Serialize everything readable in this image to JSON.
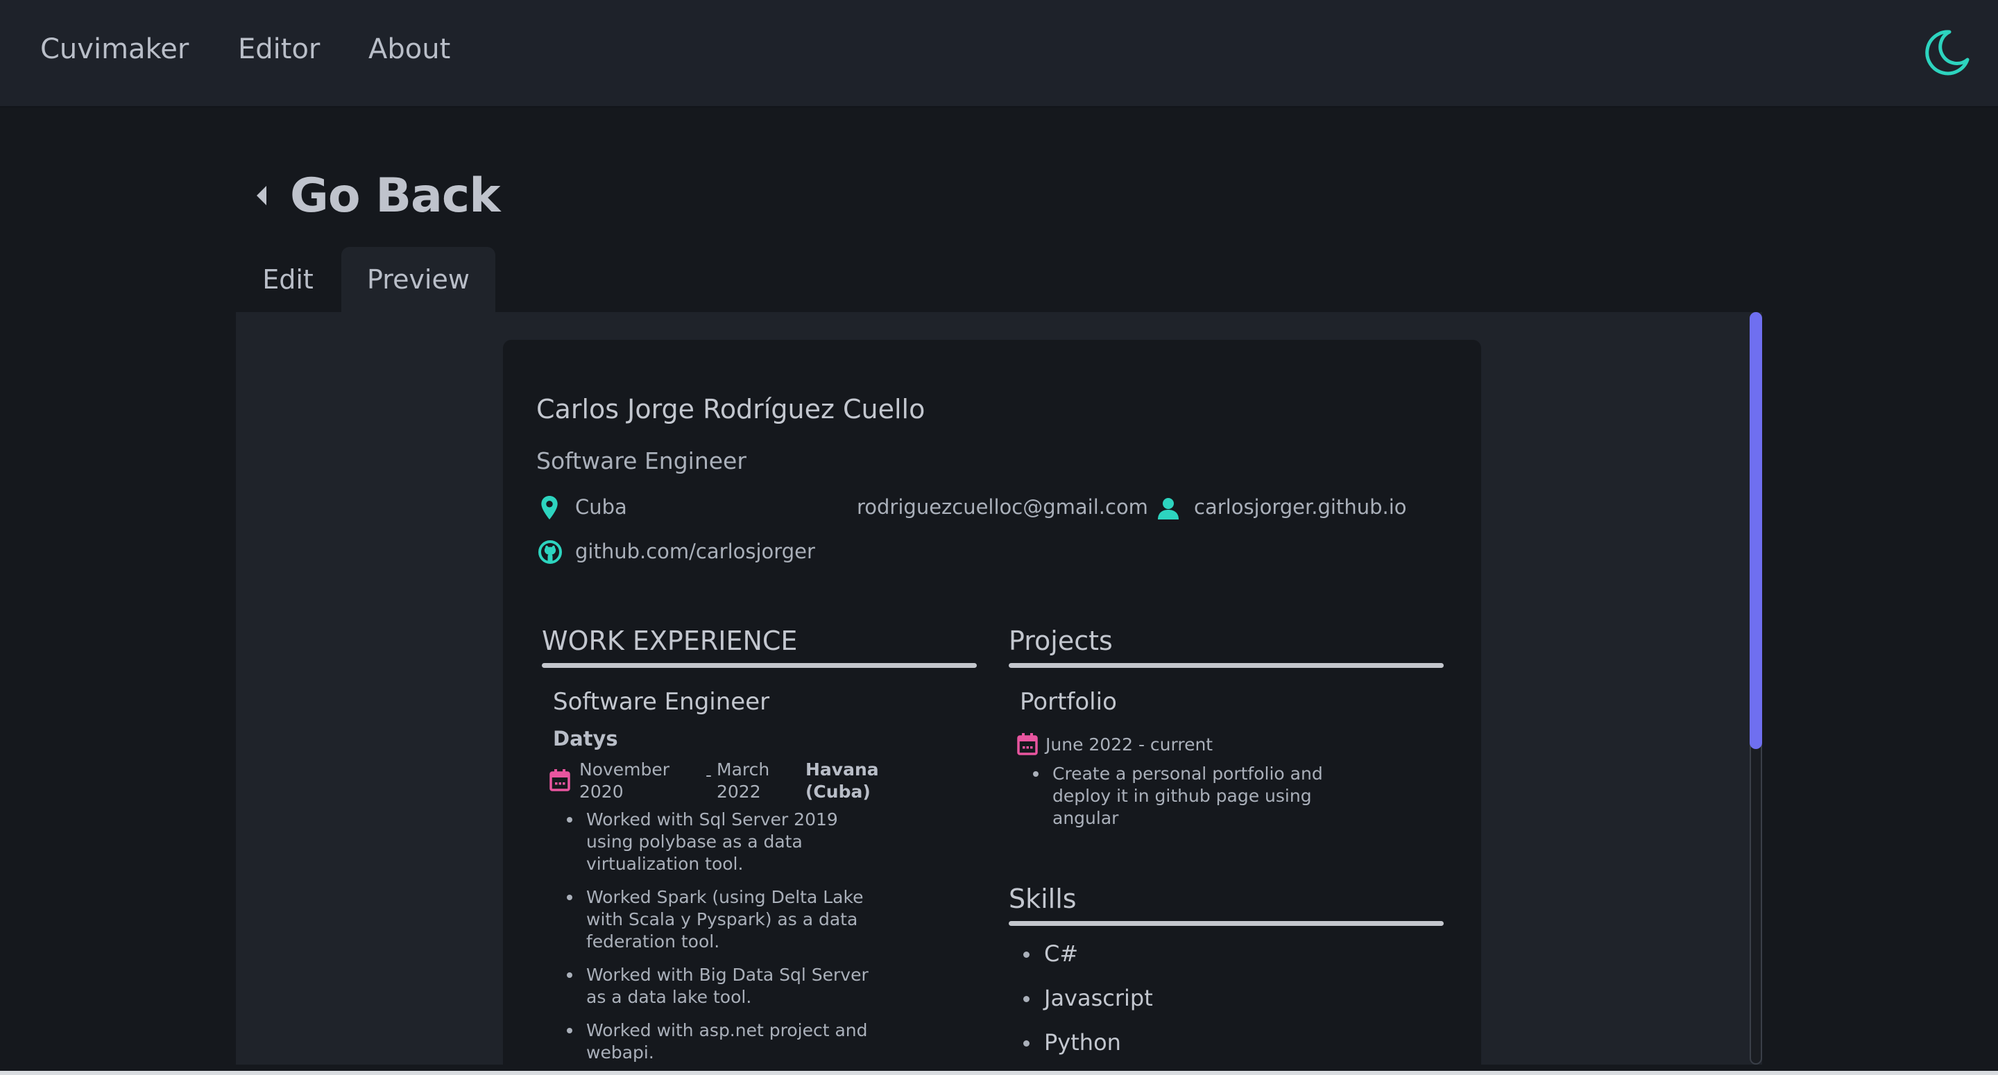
{
  "nav": {
    "brand": "Cuvimaker",
    "editor": "Editor",
    "about": "About",
    "theme_icon": "moon-icon",
    "accent": "#2dd4bf"
  },
  "back": {
    "label": "Go Back"
  },
  "tabs": [
    {
      "label": "Edit",
      "active": false
    },
    {
      "label": "Preview",
      "active": true
    }
  ],
  "resume": {
    "name": "Carlos Jorge Rodríguez Cuello",
    "title": "Software Engineer",
    "location": "Cuba",
    "email": "rodriguezcuelloc@gmail.com",
    "website": "carlosjorger.github.io",
    "github": "github.com/carlosjorger",
    "work": {
      "heading": "WORK EXPERIENCE",
      "jobs": [
        {
          "title": "Software Engineer",
          "company": "Datys",
          "start": "November 2020",
          "separator": "-",
          "end": "March 2022",
          "location": "Havana (Cuba)",
          "bullets": [
            "Worked with Sql Server 2019 using polybase as a data virtualization tool.",
            "Worked Spark (using Delta Lake with Scala y Pyspark) as a data federation tool.",
            "Worked with Big Data Sql Server as a data lake tool.",
            "Worked with asp.net project and webapi."
          ]
        }
      ]
    },
    "projects": {
      "heading": "Projects",
      "items": [
        {
          "name": "Portfolio",
          "dates": "June 2022 - current",
          "bullets": [
            "Create a personal portfolio and deploy it in github page using angular"
          ]
        }
      ]
    },
    "skills": {
      "heading": "Skills",
      "items": [
        "C#",
        "Javascript",
        "Python"
      ]
    }
  },
  "colors": {
    "icon_teal": "#2dd4bf",
    "calendar_pink": "#e8559f",
    "scroll_thumb": "#6f6ff0"
  }
}
